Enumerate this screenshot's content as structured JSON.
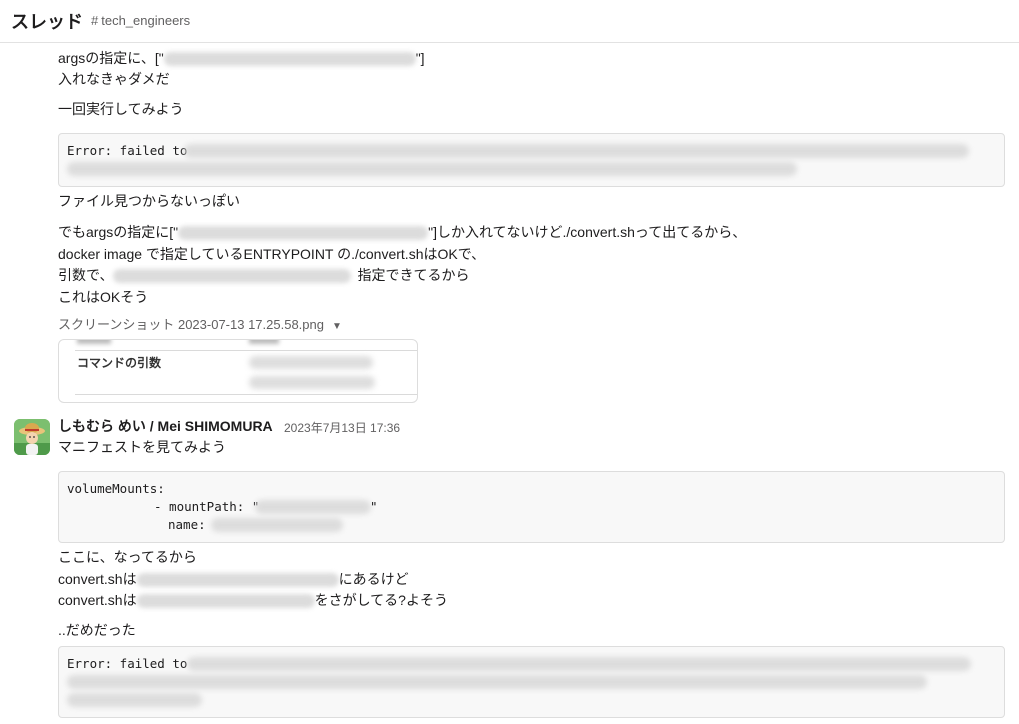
{
  "header": {
    "title": "スレッド",
    "channel_hash": "#",
    "channel_name": "tech_engineers"
  },
  "messages": {
    "line_args_prefix": "argsの指定に、[\"",
    "line_args_suffix": "\"]",
    "line_must_include": "入れなきゃダメだ",
    "line_try_once": "一回実行してみよう",
    "error1_text": "Error: failed to",
    "line_file_not_found": "ファイル見つからないっぽい",
    "line_but_args_prefix": "でもargsの指定に[\"",
    "line_but_args_suffix": "\"]しか入れてないけど./convert.shって出てるから、",
    "line_docker_image": "docker image で指定しているENTRYPOINT の./convert.shはOKで、",
    "line_args_prefix2": "引数で、",
    "line_args_suffix2": "指定できてるから",
    "line_this_ok": "これはOKそう",
    "file_name": "スクリーンショット 2023-07-13 17.25.58.png",
    "preview_label": "コマンドの引数"
  },
  "second_message": {
    "sender": "しもむら めい / Mei SHIMOMURA",
    "timestamp": "2023年7月13日 17:36",
    "line_manifest": "マニフェストを見てみよう",
    "code_volume_mounts": "volumeMounts:",
    "code_mount_path": "- mountPath: \"",
    "code_mount_path_end": "\"",
    "code_name": "name:",
    "line_here": "ここに、なってるから",
    "line_convert_is_prefix": "convert.shは",
    "line_convert_is_suffix": "にあるけど",
    "line_convert_search_prefix": "convert.shは",
    "line_convert_search_suffix": "をさがしてる?よそう",
    "line_failed": "..だめだった",
    "error2_text": "Error: failed to"
  },
  "colors": {
    "text": "#1d1c1d",
    "muted": "#616061",
    "code_bg": "#f8f8f8",
    "border": "#dddddd"
  },
  "icons": {
    "caret": "caret-down-icon",
    "avatar": "avatar"
  }
}
